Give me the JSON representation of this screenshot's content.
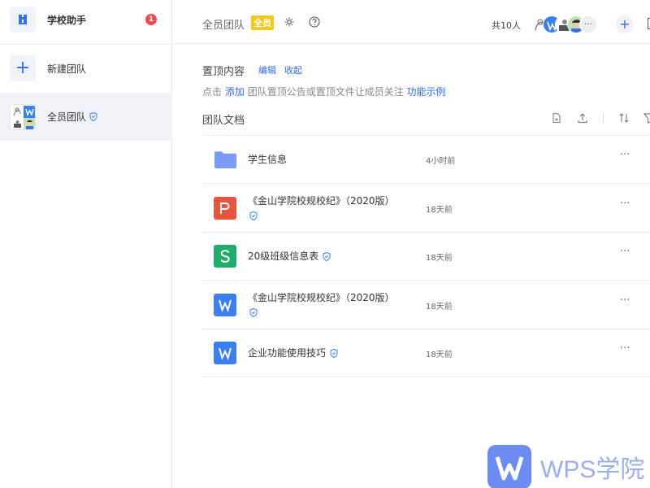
{
  "sidebar": {
    "assistant_label": "学校助手",
    "assistant_badge": "1",
    "new_team_label": "新建团队",
    "team_label": "全员团队"
  },
  "header": {
    "team_name": "全员团队",
    "tag": "全员",
    "member_count": "共10人",
    "add_symbol": "+"
  },
  "pinned": {
    "title": "置顶内容",
    "edit": "编辑",
    "collapse": "收起",
    "desc_prefix": "点击",
    "desc_add": "添加",
    "desc_middle": "团队置顶公告或置顶文件让成员关注",
    "desc_example": "功能示例"
  },
  "docs": {
    "title": "团队文档",
    "files": [
      {
        "name": "学生信息",
        "time": "4小时前",
        "type": "folder",
        "shield": false
      },
      {
        "name": "《金山学院校规校纪》（2020版）",
        "time": "18天前",
        "type": "presentation",
        "shield": true
      },
      {
        "name": "20级班级信息表",
        "time": "18天前",
        "type": "spreadsheet",
        "shield": true
      },
      {
        "name": "《金山学院校规校纪》（2020版）",
        "time": "18天前",
        "type": "document",
        "shield": true
      },
      {
        "name": "企业功能使用技巧",
        "time": "18天前",
        "type": "document",
        "shield": true
      }
    ],
    "more": "···"
  },
  "watermark": {
    "text": "WPS学院"
  },
  "colors": {
    "accent": "#2f6bf0",
    "badge": "#ef4b4b",
    "tag": "#f5c518",
    "presentation": "#e8553e",
    "spreadsheet": "#1fae6a",
    "document": "#3a7ff0"
  }
}
